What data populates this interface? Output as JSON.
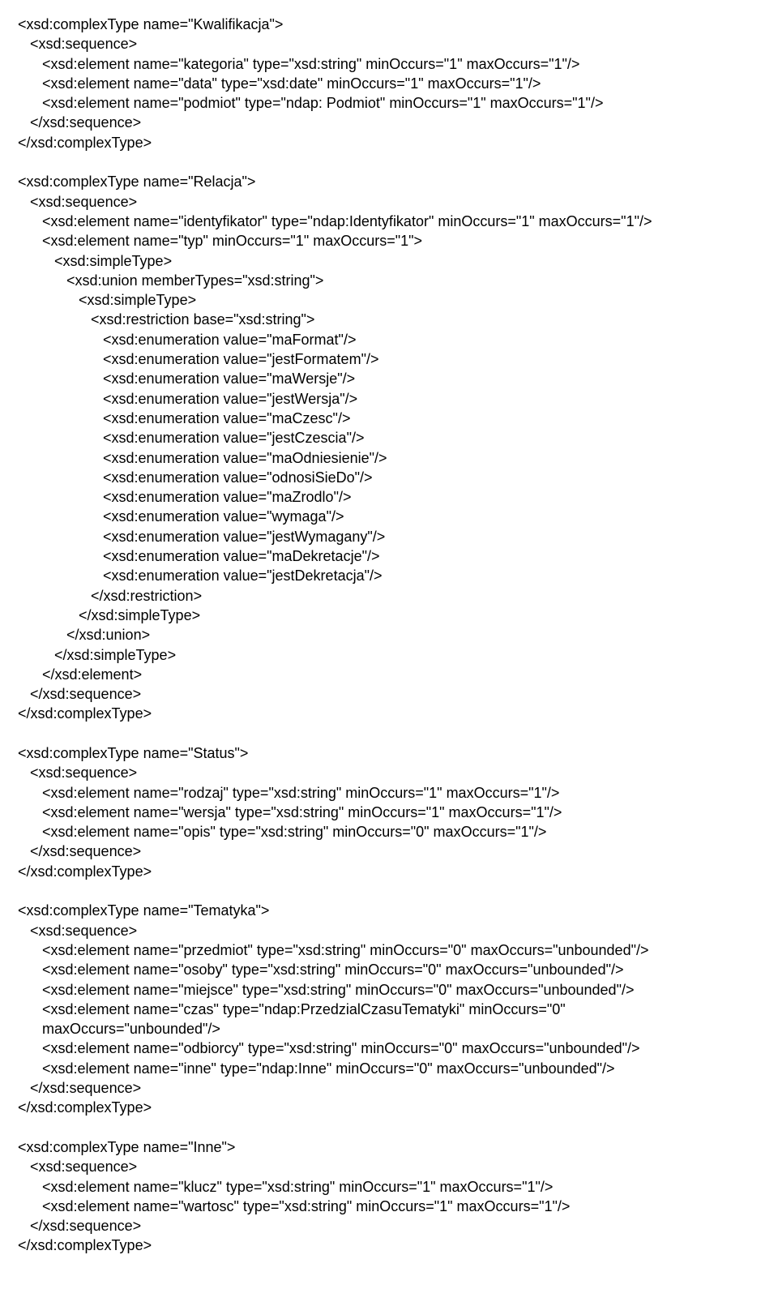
{
  "lines": [
    {
      "indent": 0,
      "text": "<xsd:complexType name=\"Kwalifikacja\">"
    },
    {
      "indent": 1,
      "text": "<xsd:sequence>"
    },
    {
      "indent": 2,
      "text": "<xsd:element name=\"kategoria\" type=\"xsd:string\" minOccurs=\"1\" maxOccurs=\"1\"/>"
    },
    {
      "indent": 2,
      "text": "<xsd:element name=\"data\" type=\"xsd:date\" minOccurs=\"1\" maxOccurs=\"1\"/>"
    },
    {
      "indent": 2,
      "text": "<xsd:element name=\"podmiot\" type=\"ndap: Podmiot\" minOccurs=\"1\" maxOccurs=\"1\"/>"
    },
    {
      "indent": 1,
      "text": "</xsd:sequence>"
    },
    {
      "indent": 0,
      "text": "</xsd:complexType>"
    },
    {
      "indent": 0,
      "text": ""
    },
    {
      "indent": 0,
      "text": "<xsd:complexType name=\"Relacja\">"
    },
    {
      "indent": 1,
      "text": "<xsd:sequence>"
    },
    {
      "indent": 2,
      "text": "<xsd:element name=\"identyfikator\" type=\"ndap:Identyfikator\" minOccurs=\"1\" maxOccurs=\"1\"/>"
    },
    {
      "indent": 2,
      "text": "<xsd:element name=\"typ\" minOccurs=\"1\" maxOccurs=\"1\">"
    },
    {
      "indent": 3,
      "text": "<xsd:simpleType>"
    },
    {
      "indent": 4,
      "text": "<xsd:union memberTypes=\"xsd:string\">"
    },
    {
      "indent": 5,
      "text": "<xsd:simpleType>"
    },
    {
      "indent": 6,
      "text": "<xsd:restriction base=\"xsd:string\">"
    },
    {
      "indent": 7,
      "text": "<xsd:enumeration value=\"maFormat\"/>"
    },
    {
      "indent": 7,
      "text": "<xsd:enumeration value=\"jestFormatem\"/>"
    },
    {
      "indent": 7,
      "text": "<xsd:enumeration value=\"maWersje\"/>"
    },
    {
      "indent": 7,
      "text": "<xsd:enumeration value=\"jestWersja\"/>"
    },
    {
      "indent": 7,
      "text": "<xsd:enumeration value=\"maCzesc\"/>"
    },
    {
      "indent": 7,
      "text": "<xsd:enumeration value=\"jestCzescia\"/>"
    },
    {
      "indent": 7,
      "text": "<xsd:enumeration value=\"maOdniesienie\"/>"
    },
    {
      "indent": 7,
      "text": "<xsd:enumeration value=\"odnosiSieDo\"/>"
    },
    {
      "indent": 7,
      "text": "<xsd:enumeration value=\"maZrodlo\"/>"
    },
    {
      "indent": 7,
      "text": "<xsd:enumeration value=\"wymaga\"/>"
    },
    {
      "indent": 7,
      "text": "<xsd:enumeration value=\"jestWymagany\"/>"
    },
    {
      "indent": 7,
      "text": "<xsd:enumeration value=\"maDekretacje\"/>"
    },
    {
      "indent": 7,
      "text": "<xsd:enumeration value=\"jestDekretacja\"/>"
    },
    {
      "indent": 6,
      "text": "</xsd:restriction>"
    },
    {
      "indent": 5,
      "text": "</xsd:simpleType>"
    },
    {
      "indent": 4,
      "text": "</xsd:union>"
    },
    {
      "indent": 3,
      "text": "</xsd:simpleType>"
    },
    {
      "indent": 2,
      "text": "</xsd:element>"
    },
    {
      "indent": 1,
      "text": "</xsd:sequence>"
    },
    {
      "indent": 0,
      "text": "</xsd:complexType>"
    },
    {
      "indent": 0,
      "text": ""
    },
    {
      "indent": 0,
      "text": "<xsd:complexType name=\"Status\">"
    },
    {
      "indent": 1,
      "text": "<xsd:sequence>"
    },
    {
      "indent": 2,
      "text": "<xsd:element name=\"rodzaj\" type=\"xsd:string\" minOccurs=\"1\" maxOccurs=\"1\"/>"
    },
    {
      "indent": 2,
      "text": "<xsd:element name=\"wersja\" type=\"xsd:string\" minOccurs=\"1\" maxOccurs=\"1\"/>"
    },
    {
      "indent": 2,
      "text": "<xsd:element name=\"opis\" type=\"xsd:string\" minOccurs=\"0\" maxOccurs=\"1\"/>"
    },
    {
      "indent": 1,
      "text": "</xsd:sequence>"
    },
    {
      "indent": 0,
      "text": "</xsd:complexType>"
    },
    {
      "indent": 0,
      "text": ""
    },
    {
      "indent": 0,
      "text": "<xsd:complexType name=\"Tematyka\">"
    },
    {
      "indent": 1,
      "text": "<xsd:sequence>"
    },
    {
      "indent": 2,
      "text": "<xsd:element name=\"przedmiot\" type=\"xsd:string\" minOccurs=\"0\" maxOccurs=\"unbounded\"/>"
    },
    {
      "indent": 2,
      "text": "<xsd:element name=\"osoby\" type=\"xsd:string\" minOccurs=\"0\" maxOccurs=\"unbounded\"/>"
    },
    {
      "indent": 2,
      "text": "<xsd:element name=\"miejsce\" type=\"xsd:string\" minOccurs=\"0\" maxOccurs=\"unbounded\"/>"
    },
    {
      "indent": 2,
      "text": "<xsd:element name=\"czas\" type=\"ndap:PrzedzialCzasuTematyki\" minOccurs=\"0\""
    },
    {
      "indent": 2,
      "text": "maxOccurs=\"unbounded\"/>"
    },
    {
      "indent": 2,
      "text": "<xsd:element name=\"odbiorcy\" type=\"xsd:string\" minOccurs=\"0\" maxOccurs=\"unbounded\"/>"
    },
    {
      "indent": 2,
      "text": "<xsd:element name=\"inne\" type=\"ndap:Inne\" minOccurs=\"0\" maxOccurs=\"unbounded\"/>"
    },
    {
      "indent": 1,
      "text": "</xsd:sequence>"
    },
    {
      "indent": 0,
      "text": "</xsd:complexType>"
    },
    {
      "indent": 0,
      "text": ""
    },
    {
      "indent": 0,
      "text": "<xsd:complexType name=\"Inne\">"
    },
    {
      "indent": 1,
      "text": "<xsd:sequence>"
    },
    {
      "indent": 2,
      "text": "<xsd:element name=\"klucz\" type=\"xsd:string\" minOccurs=\"1\" maxOccurs=\"1\"/>"
    },
    {
      "indent": 2,
      "text": "<xsd:element name=\"wartosc\" type=\"xsd:string\" minOccurs=\"1\" maxOccurs=\"1\"/>"
    },
    {
      "indent": 1,
      "text": "</xsd:sequence>"
    },
    {
      "indent": 0,
      "text": "</xsd:complexType>"
    }
  ],
  "indent_unit": "   "
}
